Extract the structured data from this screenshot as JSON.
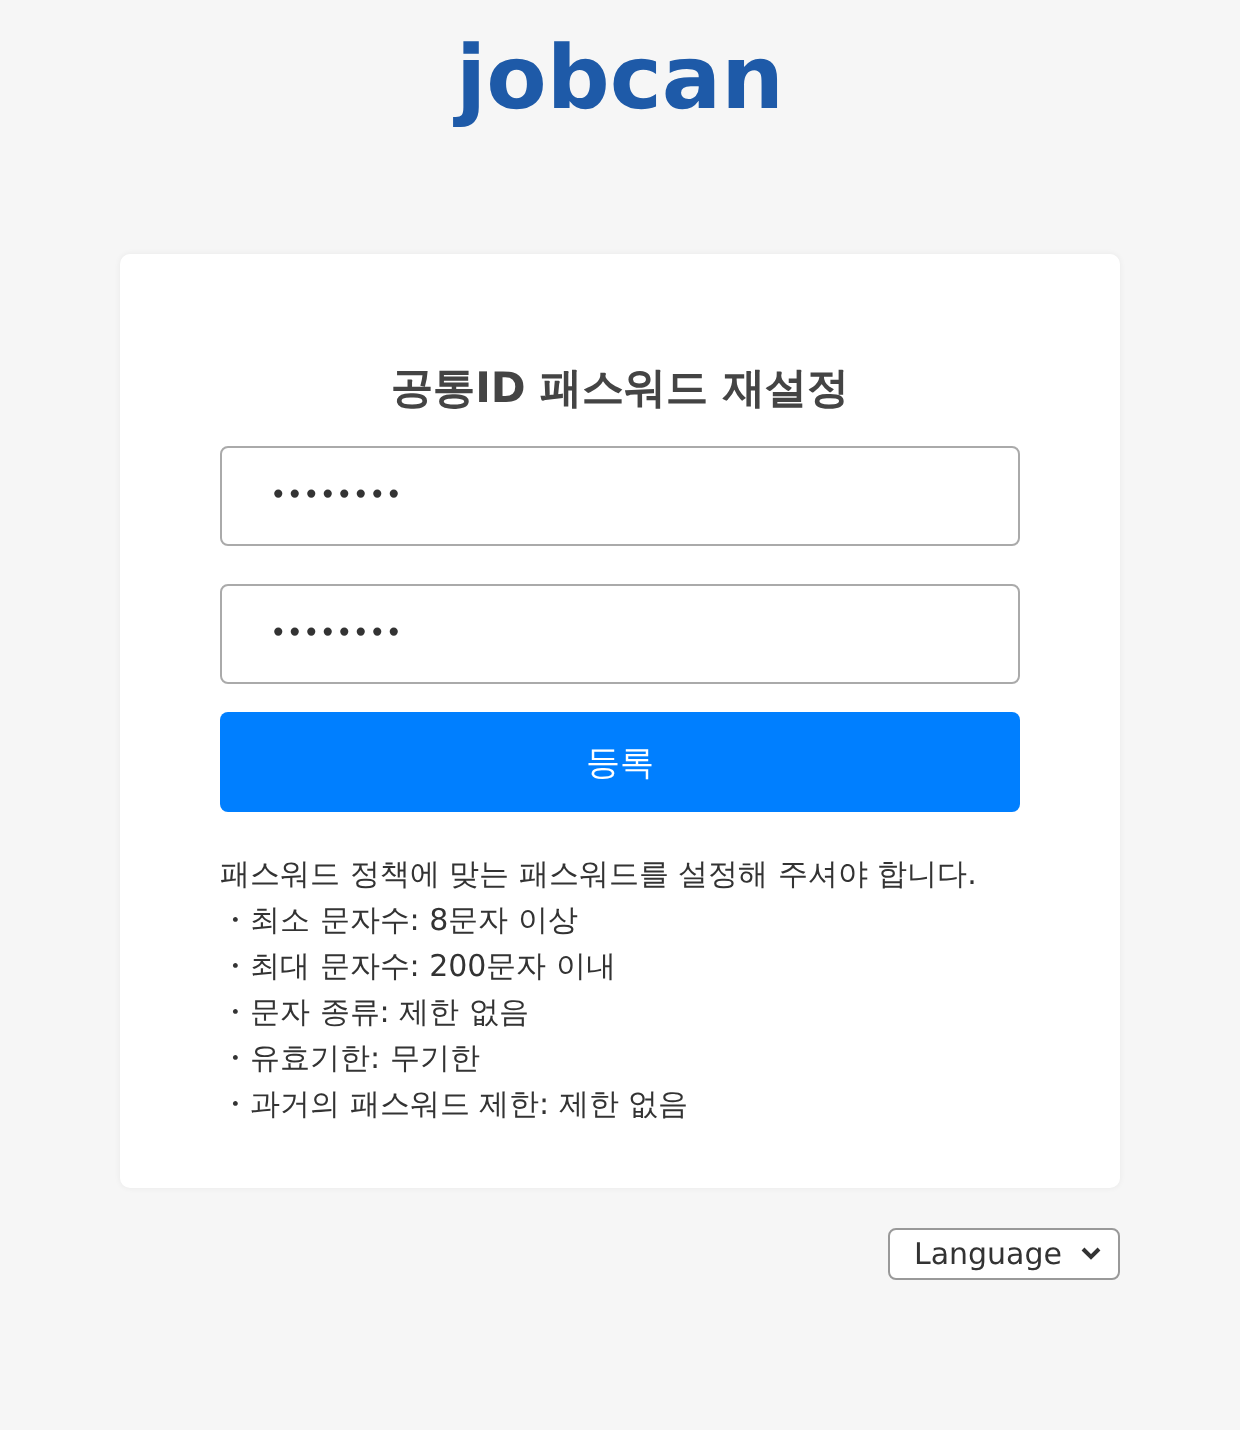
{
  "logo": {
    "text": "jobcan"
  },
  "title": "공통ID 패스워드 재설정",
  "fields": [
    {
      "value": "••••••••"
    },
    {
      "value": "••••••••"
    }
  ],
  "submit_button": "등록",
  "policy": {
    "intro": "패스워드 정책에 맞는 패스워드를 설정해 주셔야 합니다.",
    "rules": [
      "・최소 문자수: 8문자 이상",
      "・최대 문자수: 200문자 이내",
      "・문자 종류: 제한 없음",
      "・유효기한: 무기한",
      "・과거의 패스워드 제한: 제한 없음"
    ]
  },
  "language_select": {
    "value": "Language"
  }
}
